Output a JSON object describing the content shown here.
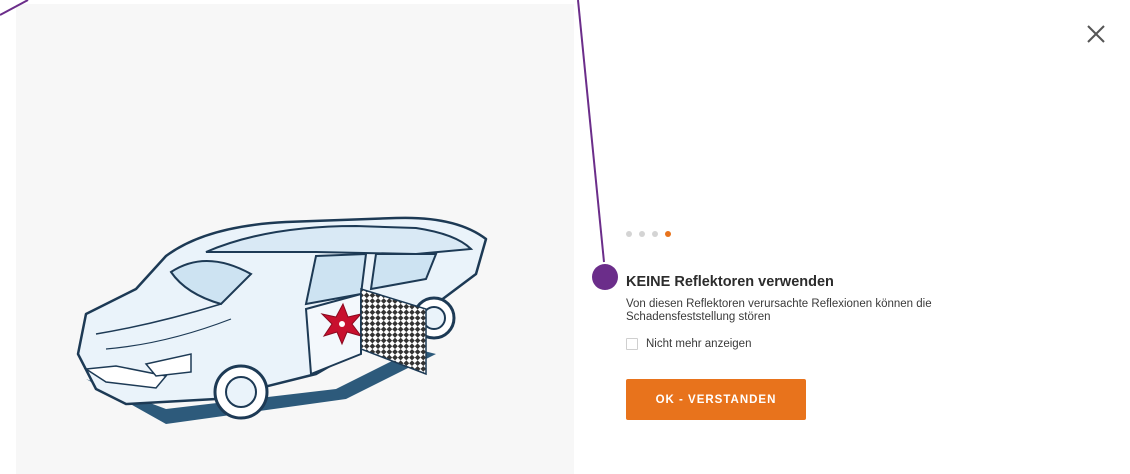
{
  "dialog": {
    "title": "KEINE Reflektoren verwenden",
    "description": "Von diesen Reflektoren verursachte Reflexionen können die Schadensfeststellung stören",
    "checkbox_label": "Nicht mehr anzeigen",
    "checkbox_checked": false,
    "ok_label": "OK - VERSTANDEN",
    "step_current": 4,
    "step_total": 4
  },
  "icons": {
    "close": "close-icon",
    "illustration": "car-with-reflector-illustration"
  },
  "colors": {
    "accent": "#e8731c",
    "dot_inactive": "#d4d4d4",
    "annotation": "#6b2d8a",
    "damage": "#c8102e"
  }
}
